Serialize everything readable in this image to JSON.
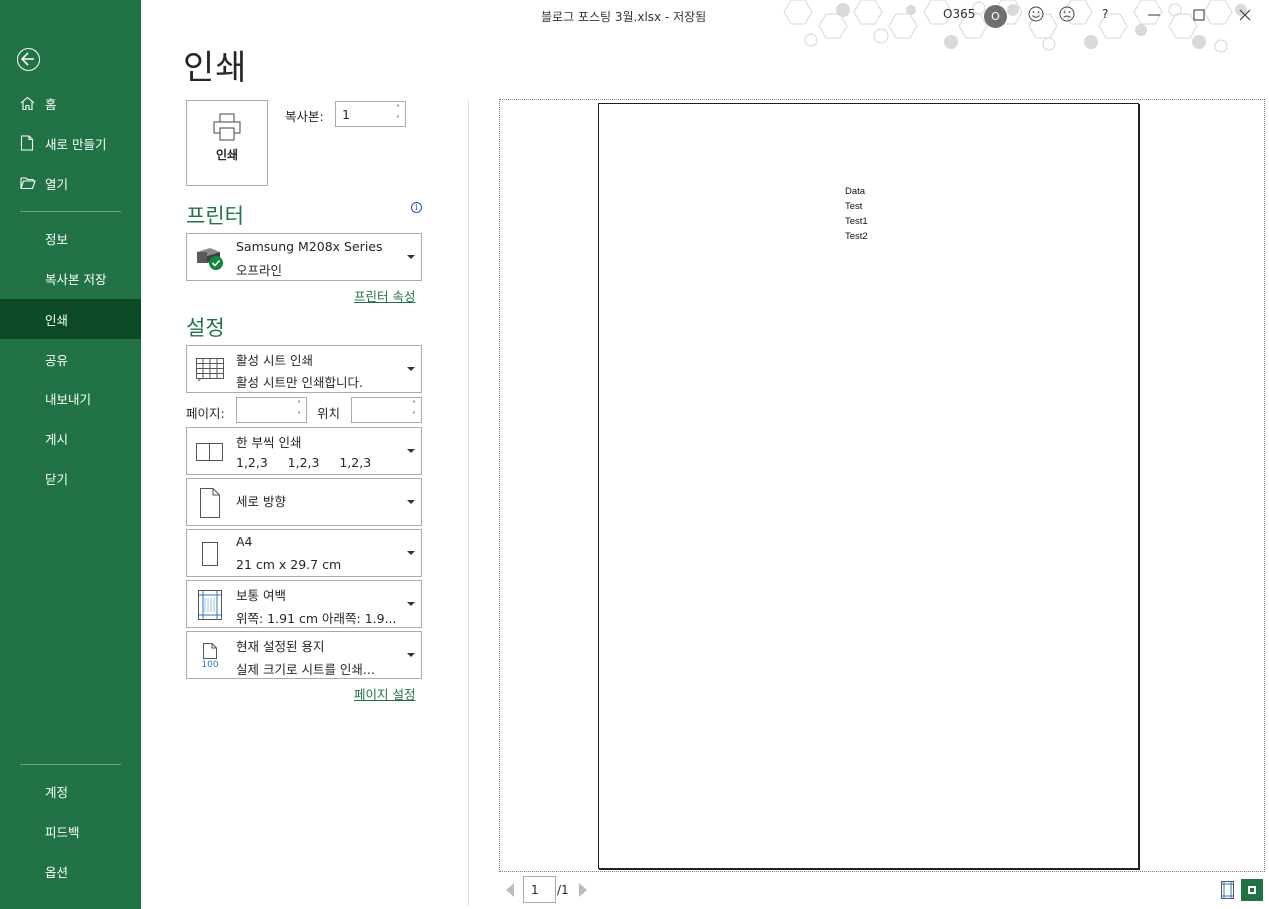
{
  "window": {
    "title": "블로그 포스팅 3월.xlsx - 저장됨",
    "account_label": "O365",
    "avatar_initial": "O",
    "help": "?"
  },
  "nav": {
    "top_items": [
      {
        "label": "홈",
        "icon": "home-icon"
      },
      {
        "label": "새로 만들기",
        "icon": "new-document-icon"
      },
      {
        "label": "열기",
        "icon": "open-folder-icon"
      }
    ],
    "mid_items": [
      "정보",
      "복사본 저장",
      "인쇄",
      "공유",
      "내보내기",
      "게시",
      "닫기"
    ],
    "active": "인쇄",
    "bottom_items": [
      "계정",
      "피드백",
      "옵션"
    ]
  },
  "page": {
    "heading": "인쇄",
    "print_button": "인쇄",
    "copies_label": "복사본:",
    "copies_value": "1",
    "printer_section": "프린터",
    "printer": {
      "name": "Samsung M208x Series",
      "status": "오프라인"
    },
    "printer_properties_link": "프린터 속성",
    "settings_section": "설정",
    "settings": [
      {
        "l1": "활성 시트 인쇄",
        "l2": "활성 시트만 인쇄합니다.",
        "icon": "sheet-grid-icon"
      },
      {
        "l1": "한 부씩 인쇄",
        "l2": "1,2,3     1,2,3     1,2,3",
        "icon": "collate-icon"
      },
      {
        "l1": "세로 방향",
        "l2": "",
        "icon": "portrait-page-icon"
      },
      {
        "l1": "A4",
        "l2": "21 cm x 29.7 cm",
        "icon": "paper-size-icon"
      },
      {
        "l1": "보통 여백",
        "l2": "위쪽: 1.91 cm 아래쪽: 1.9...",
        "icon": "margins-icon"
      },
      {
        "l1": "현재 설정된 용지",
        "l2": "실제 크기로 시트를 인쇄...",
        "icon": "scaling-100-icon",
        "icon_text": "100"
      }
    ],
    "pages_label": "페이지:",
    "pages_to_label": "위치",
    "page_setup_link": "페이지 설정"
  },
  "preview": {
    "cells": [
      "Data",
      "Test",
      "Test1",
      "Test2"
    ],
    "current_page": "1",
    "total_pages": "/1"
  },
  "colors": {
    "accent": "#217346",
    "active_nav": "#0c4a25"
  }
}
